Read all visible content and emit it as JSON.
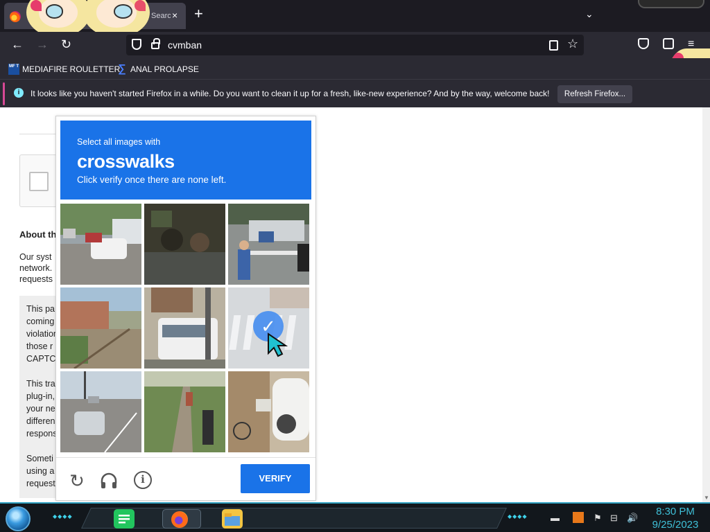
{
  "browser": {
    "tab_title": "Searc",
    "tab_close_icon": "×",
    "new_tab_icon": "+",
    "tab_list_icon": "⌄",
    "url": "cvmban",
    "bookmarks": [
      {
        "label": "MEDIAFIRE ROULETTER",
        "icon": "mediafire-icon",
        "icon_text": "MF T"
      },
      {
        "label": "ANAL PROLAPSE",
        "icon": "sigma-icon",
        "icon_text": "∑"
      }
    ],
    "notification": {
      "text": "It looks like you haven't started Firefox in a while. Do you want to clean it up for a fresh, like-new experience? And by the way, welcome back!",
      "button_label": "Refresh Firefox..."
    }
  },
  "page": {
    "about_title": "About th",
    "about_text": "Our syst network. requests",
    "grey_paragraphs": [
      "This pa coming violation those r CAPTC",
      "This tra plug-in, your ne differen respons",
      "Someti using a request"
    ]
  },
  "captcha": {
    "instruction_pre": "Select all images with",
    "target": "crosswalks",
    "instruction_post": "Click verify once there are none left.",
    "selected_tiles": [
      5
    ],
    "verify_label": "VERIFY",
    "check_glyph": "✓",
    "info_glyph": "i",
    "reload_glyph": "↻",
    "headphones_glyph": "🎧",
    "accent_color": "#1a73e8"
  },
  "taskbar": {
    "time": "8:30 PM",
    "date": "9/25/2023"
  }
}
